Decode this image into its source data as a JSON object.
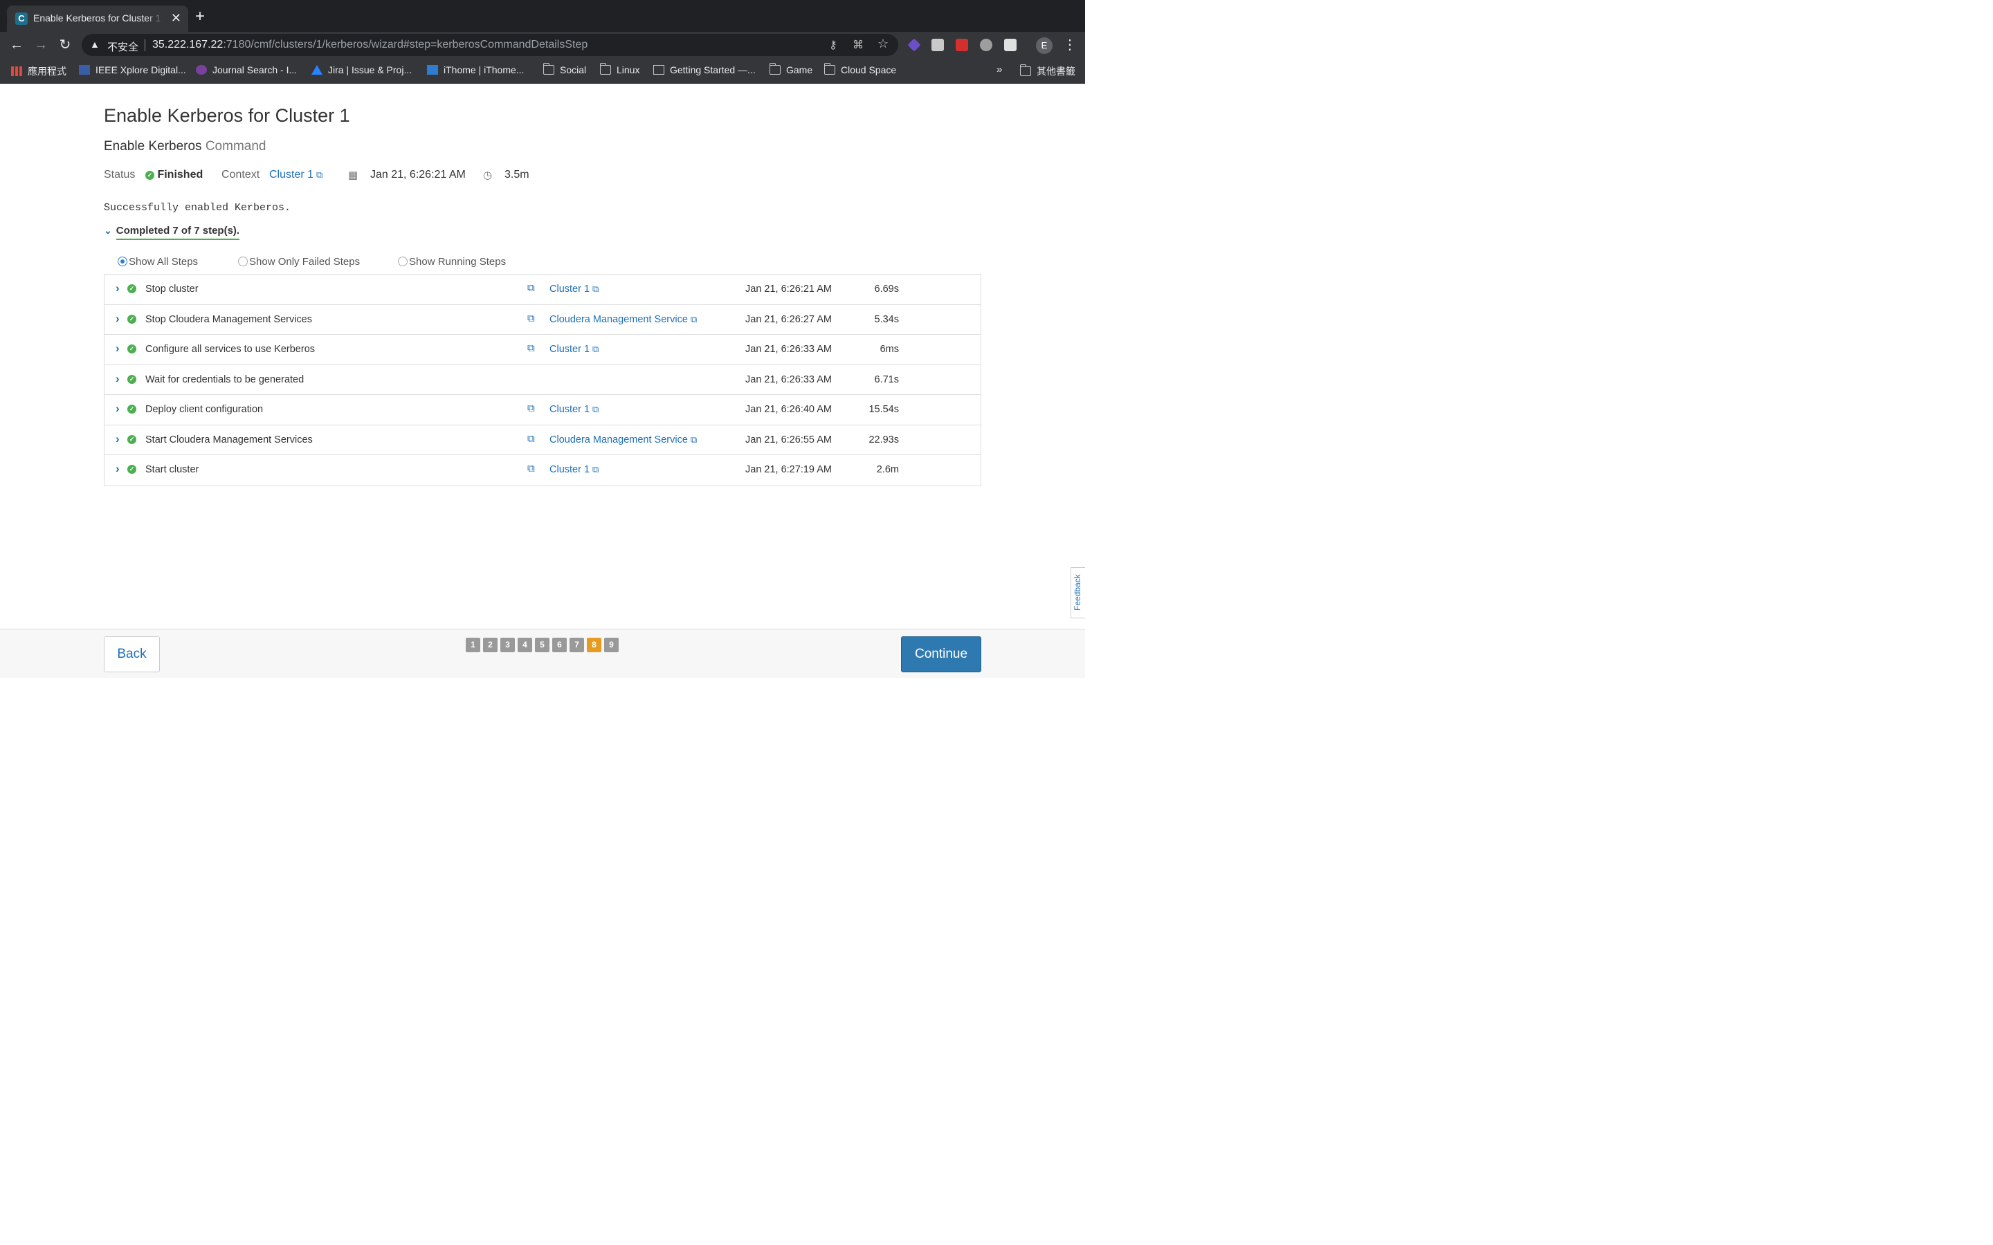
{
  "browser": {
    "tab_title": "Enable Kerberos for Cluster 1 -",
    "tab_favicon_letter": "C",
    "insecure_label": "不安全",
    "url_host": "35.222.167.22",
    "url_rest": ":7180/cmf/clusters/1/kerberos/wizard#step=kerberosCommandDetailsStep",
    "profile_initial": "E",
    "bookmarks": [
      {
        "label": "應用程式"
      },
      {
        "label": "IEEE Xplore Digital..."
      },
      {
        "label": "Journal Search - I..."
      },
      {
        "label": "Jira | Issue & Proj..."
      },
      {
        "label": "iThome | iThome..."
      },
      {
        "label": "Social"
      },
      {
        "label": "Linux"
      },
      {
        "label": "Getting Started —..."
      },
      {
        "label": "Game"
      },
      {
        "label": "Cloud Space"
      }
    ],
    "other_bookmarks": "其他書籤",
    "overflow": "»"
  },
  "page": {
    "title": "Enable Kerberos for Cluster 1",
    "command_name": "Enable Kerberos",
    "command_suffix": "Command",
    "status_label": "Status",
    "status_value": "Finished",
    "context_label": "Context",
    "context_value": "Cluster 1",
    "start_time": "Jan 21, 6:26:21 AM",
    "duration": "3.5m",
    "success_message": "Successfully enabled Kerberos.",
    "completed_text": "Completed 7 of 7 step(s).",
    "filters": {
      "all": "Show All Steps",
      "failed": "Show Only Failed Steps",
      "running": "Show Running Steps",
      "selected": "all"
    },
    "steps": [
      {
        "name": "Stop cluster",
        "context": "Cluster 1",
        "time": "Jan 21, 6:26:21 AM",
        "duration": "6.69s"
      },
      {
        "name": "Stop Cloudera Management Services",
        "context": "Cloudera Management Service",
        "time": "Jan 21, 6:26:27 AM",
        "duration": "5.34s"
      },
      {
        "name": "Configure all services to use Kerberos",
        "context": "Cluster 1",
        "time": "Jan 21, 6:26:33 AM",
        "duration": "6ms"
      },
      {
        "name": "Wait for credentials to be generated",
        "context": "",
        "time": "Jan 21, 6:26:33 AM",
        "duration": "6.71s"
      },
      {
        "name": "Deploy client configuration",
        "context": "Cluster 1",
        "time": "Jan 21, 6:26:40 AM",
        "duration": "15.54s"
      },
      {
        "name": "Start Cloudera Management Services",
        "context": "Cloudera Management Service",
        "time": "Jan 21, 6:26:55 AM",
        "duration": "22.93s"
      },
      {
        "name": "Start cluster",
        "context": "Cluster 1",
        "time": "Jan 21, 6:27:19 AM",
        "duration": "2.6m"
      }
    ],
    "feedback": "Feedback"
  },
  "footer": {
    "back_label": "Back",
    "continue_label": "Continue",
    "pages": [
      "1",
      "2",
      "3",
      "4",
      "5",
      "6",
      "7",
      "8",
      "9"
    ],
    "active_page": "8"
  },
  "colors": {
    "accent": "#1f70b8",
    "success": "#4caf50",
    "active_page": "#e79b21",
    "continue_button": "#2e79b0"
  }
}
